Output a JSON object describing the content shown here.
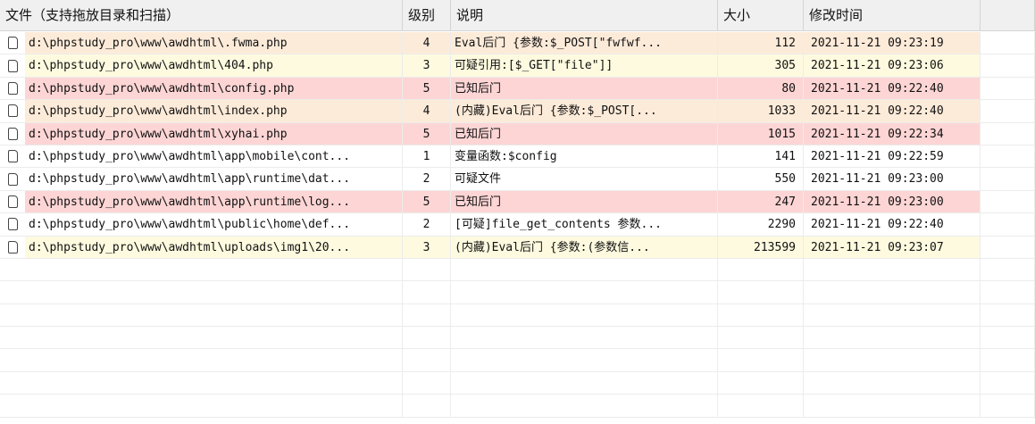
{
  "columns": [
    "文件（支持拖放目录和扫描）",
    "级别",
    "说明",
    "大小",
    "修改时间"
  ],
  "colors": {
    "level4": "#fdebd9",
    "level3": "#fdfadf",
    "level5": "#fdd5d5",
    "level1": "#ffffff",
    "level2": "#ffffff"
  },
  "rows": [
    {
      "path": "d:\\phpstudy_pro\\www\\awdhtml\\.fwma.php",
      "level": "4",
      "desc": "Eval后门 {参数:$_POST[\"fwfwf...",
      "size": "112",
      "time": "2021-11-21 09:23:19"
    },
    {
      "path": "d:\\phpstudy_pro\\www\\awdhtml\\404.php",
      "level": "3",
      "desc": "可疑引用:[$_GET[\"file\"]]",
      "size": "305",
      "time": "2021-11-21 09:23:06"
    },
    {
      "path": "d:\\phpstudy_pro\\www\\awdhtml\\config.php",
      "level": "5",
      "desc": "已知后门",
      "size": "80",
      "time": "2021-11-21 09:22:40"
    },
    {
      "path": "d:\\phpstudy_pro\\www\\awdhtml\\index.php",
      "level": "4",
      "desc": "(内藏)Eval后门 {参数:$_POST[...",
      "size": "1033",
      "time": "2021-11-21 09:22:40"
    },
    {
      "path": "d:\\phpstudy_pro\\www\\awdhtml\\xyhai.php",
      "level": "5",
      "desc": "已知后门",
      "size": "1015",
      "time": "2021-11-21 09:22:34"
    },
    {
      "path": "d:\\phpstudy_pro\\www\\awdhtml\\app\\mobile\\cont...",
      "level": "1",
      "desc": "变量函数:$config",
      "size": "141",
      "time": "2021-11-21 09:22:59"
    },
    {
      "path": "d:\\phpstudy_pro\\www\\awdhtml\\app\\runtime\\dat...",
      "level": "2",
      "desc": "可疑文件",
      "size": "550",
      "time": "2021-11-21 09:23:00"
    },
    {
      "path": "d:\\phpstudy_pro\\www\\awdhtml\\app\\runtime\\log...",
      "level": "5",
      "desc": "已知后门",
      "size": "247",
      "time": "2021-11-21 09:23:00"
    },
    {
      "path": "d:\\phpstudy_pro\\www\\awdhtml\\public\\home\\def...",
      "level": "2",
      "desc": "[可疑]file_get_contents 参数...",
      "size": "2290",
      "time": "2021-11-21 09:22:40"
    },
    {
      "path": "d:\\phpstudy_pro\\www\\awdhtml\\uploads\\img1\\20...",
      "level": "3",
      "desc": "(内藏)Eval后门 {参数:(参数信...",
      "size": "213599",
      "time": "2021-11-21 09:23:07"
    }
  ]
}
